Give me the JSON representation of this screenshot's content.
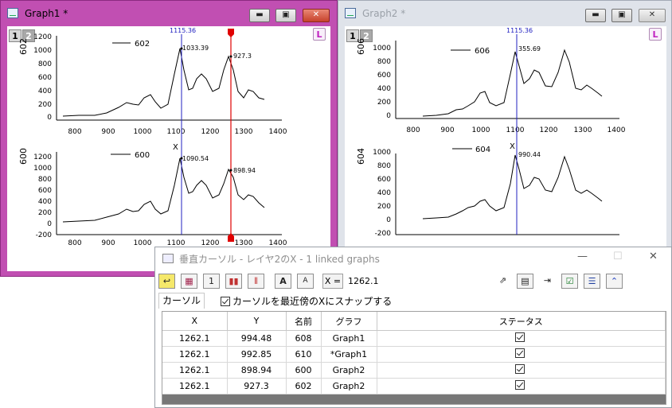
{
  "graph1": {
    "title": "Graph1 *",
    "layer_tabs": [
      "1",
      "2"
    ],
    "link_button": "L",
    "cursor_x_label": "1115.36",
    "panels": [
      {
        "legend": "602",
        "ylabel": "602",
        "yticks": [
          "0",
          "200",
          "400",
          "600",
          "800",
          "1000",
          "1200"
        ],
        "annotations": [
          "1033.39",
          "927.3"
        ]
      },
      {
        "legend": "600",
        "ylabel": "600",
        "xlabel": "X",
        "yticks": [
          "-200",
          "0",
          "200",
          "400",
          "600",
          "800",
          "1000",
          "1200"
        ],
        "annotations": [
          "1090.54",
          "898.94"
        ]
      }
    ],
    "xticks": [
      "800",
      "900",
      "1000",
      "1100",
      "1200",
      "1300",
      "1400"
    ]
  },
  "graph2": {
    "title": "Graph2 *",
    "layer_tabs": [
      "1",
      "2"
    ],
    "link_button": "L",
    "cursor_x_label": "1115.36",
    "panels": [
      {
        "legend": "606",
        "ylabel": "606",
        "yticks": [
          "0",
          "200",
          "400",
          "600",
          "800",
          "1000"
        ],
        "annotations": [
          "355.69"
        ]
      },
      {
        "legend": "604",
        "ylabel": "604",
        "xlabel": "X",
        "yticks": [
          "-200",
          "0",
          "200",
          "400",
          "600",
          "800",
          "1000"
        ],
        "annotations": [
          "990.44"
        ]
      }
    ],
    "xticks": [
      "800",
      "900",
      "1000",
      "1100",
      "1200",
      "1300",
      "1400"
    ]
  },
  "dialog": {
    "title": "垂直カーソル - レイヤ2のX - 1 linked graphs",
    "x_label": "X =",
    "x_value": "1262.1",
    "tab": "カーソル",
    "snap_label": "カーソルを最近傍のXにスナップする",
    "columns": [
      "X",
      "Y",
      "名前",
      "グラフ",
      "ステータス"
    ],
    "rows": [
      [
        "1262.1",
        "994.48",
        "608",
        "Graph1"
      ],
      [
        "1262.1",
        "992.85",
        "610",
        "*Graph1"
      ],
      [
        "1262.1",
        "898.94",
        "600",
        "Graph2"
      ],
      [
        "1262.1",
        "927.3",
        "602",
        "Graph2"
      ]
    ],
    "toolbar_icons": [
      "cursor-tool-icon",
      "clipboard-icon",
      "layer-1-icon",
      "multi-layer-icon",
      "range-icon",
      "text-size-up-icon",
      "text-size-down-icon",
      "export-icon",
      "worksheet-icon",
      "new-sheet-icon",
      "checklist-icon",
      "settings-icon",
      "collapse-icon"
    ]
  },
  "colors": {
    "graph1_frame": "#c14fb2",
    "cursor_blue": "#2020c0",
    "cursor_red": "#e00000"
  }
}
